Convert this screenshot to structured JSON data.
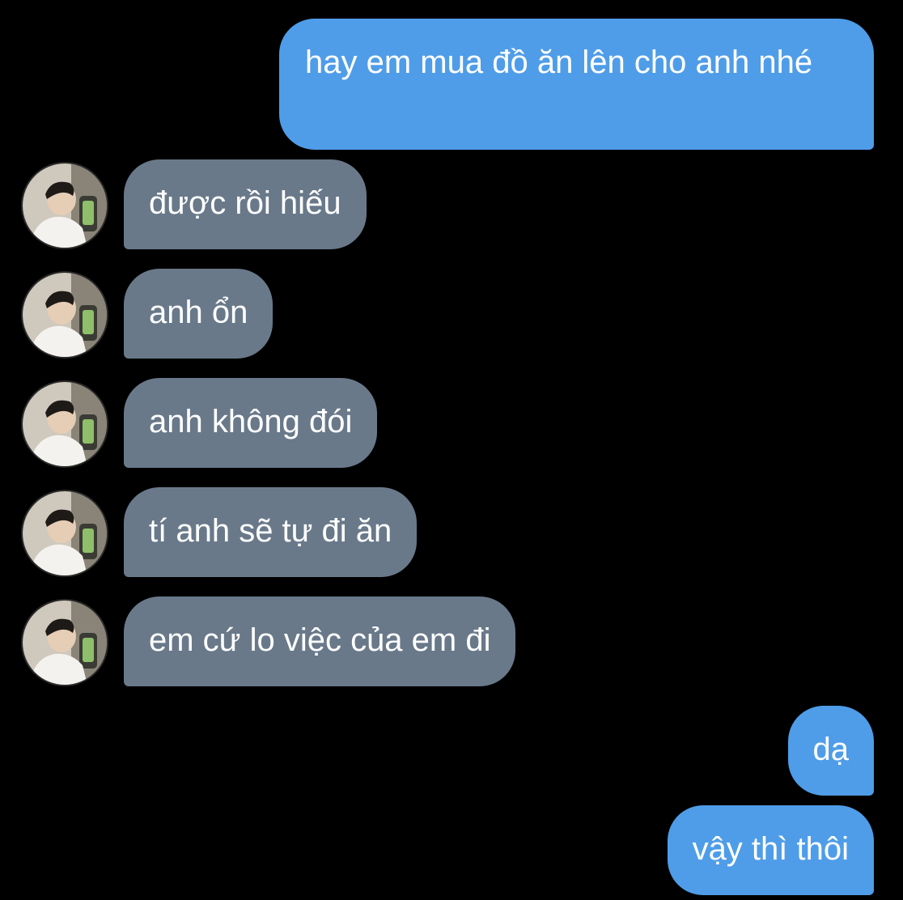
{
  "colors": {
    "background": "#000000",
    "sent_bubble": "#4f9de8",
    "received_bubble": "#69798a",
    "text": "#ffffff"
  },
  "messages": [
    {
      "direction": "sent",
      "text": "hay em mua đồ ăn lên cho anh nhé"
    },
    {
      "direction": "received",
      "text": "được rồi hiếu",
      "avatar": "contact-avatar"
    },
    {
      "direction": "received",
      "text": "anh ổn",
      "avatar": "contact-avatar"
    },
    {
      "direction": "received",
      "text": "anh không đói",
      "avatar": "contact-avatar"
    },
    {
      "direction": "received",
      "text": "tí anh sẽ tự đi ăn",
      "avatar": "contact-avatar"
    },
    {
      "direction": "received",
      "text": "em cứ lo việc của em đi",
      "avatar": "contact-avatar"
    },
    {
      "direction": "sent",
      "text": "dạ"
    },
    {
      "direction": "sent",
      "text": "vậy thì thôi"
    }
  ]
}
